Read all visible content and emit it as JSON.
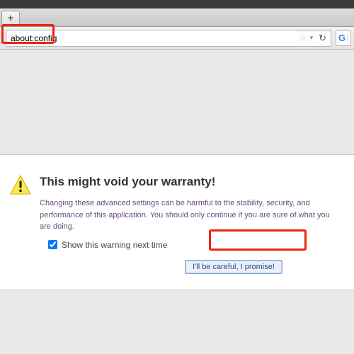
{
  "tabstrip": {
    "newtab_glyph": "+"
  },
  "nav": {
    "url_value": "about:config",
    "star_glyph": "☆",
    "dropdown_glyph": "▾",
    "reload_glyph": "↻",
    "search_btn_letter": "G"
  },
  "warning": {
    "title": "This might void your warranty!",
    "message": "Changing these advanced settings can be harmful to the stability, security, and performance of this application. You should only continue if you are sure of what you are doing.",
    "checkbox_label": "Show this warning next time",
    "checkbox_checked": true,
    "button_label": "I'll be careful, I promise!"
  }
}
